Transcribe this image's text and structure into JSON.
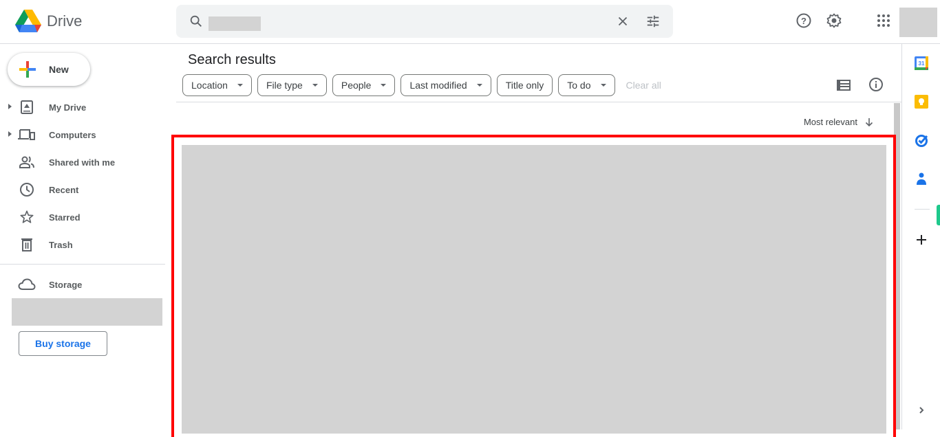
{
  "app": {
    "name": "Drive"
  },
  "header": {
    "search_value": "",
    "icons": [
      "search-icon",
      "close-icon",
      "tune-icon",
      "help-icon",
      "settings-icon",
      "apps-icon"
    ]
  },
  "sidebar": {
    "new_label": "New",
    "items": [
      {
        "label": "My Drive",
        "icon": "my-drive-icon",
        "expandable": true
      },
      {
        "label": "Computers",
        "icon": "computers-icon",
        "expandable": true
      },
      {
        "label": "Shared with me",
        "icon": "shared-icon",
        "expandable": false
      },
      {
        "label": "Recent",
        "icon": "clock-icon",
        "expandable": false
      },
      {
        "label": "Starred",
        "icon": "star-icon",
        "expandable": false
      },
      {
        "label": "Trash",
        "icon": "trash-icon",
        "expandable": false
      }
    ],
    "storage_label": "Storage",
    "buy_storage_label": "Buy storage"
  },
  "main": {
    "title": "Search results",
    "filters": [
      {
        "label": "Location",
        "dropdown": true
      },
      {
        "label": "File type",
        "dropdown": true
      },
      {
        "label": "People",
        "dropdown": true
      },
      {
        "label": "Last modified",
        "dropdown": true
      },
      {
        "label": "Title only",
        "dropdown": false
      },
      {
        "label": "To do",
        "dropdown": true
      }
    ],
    "clear_all": "Clear all",
    "sort_label": "Most relevant"
  },
  "side_panel": {
    "apps": [
      "Calendar",
      "Keep",
      "Tasks",
      "Contacts"
    ],
    "calendar_day": "31"
  },
  "colors": {
    "accent_blue": "#1a73e8",
    "highlight_red": "#ff0000",
    "placeholder_gray": "#d3d3d3"
  }
}
